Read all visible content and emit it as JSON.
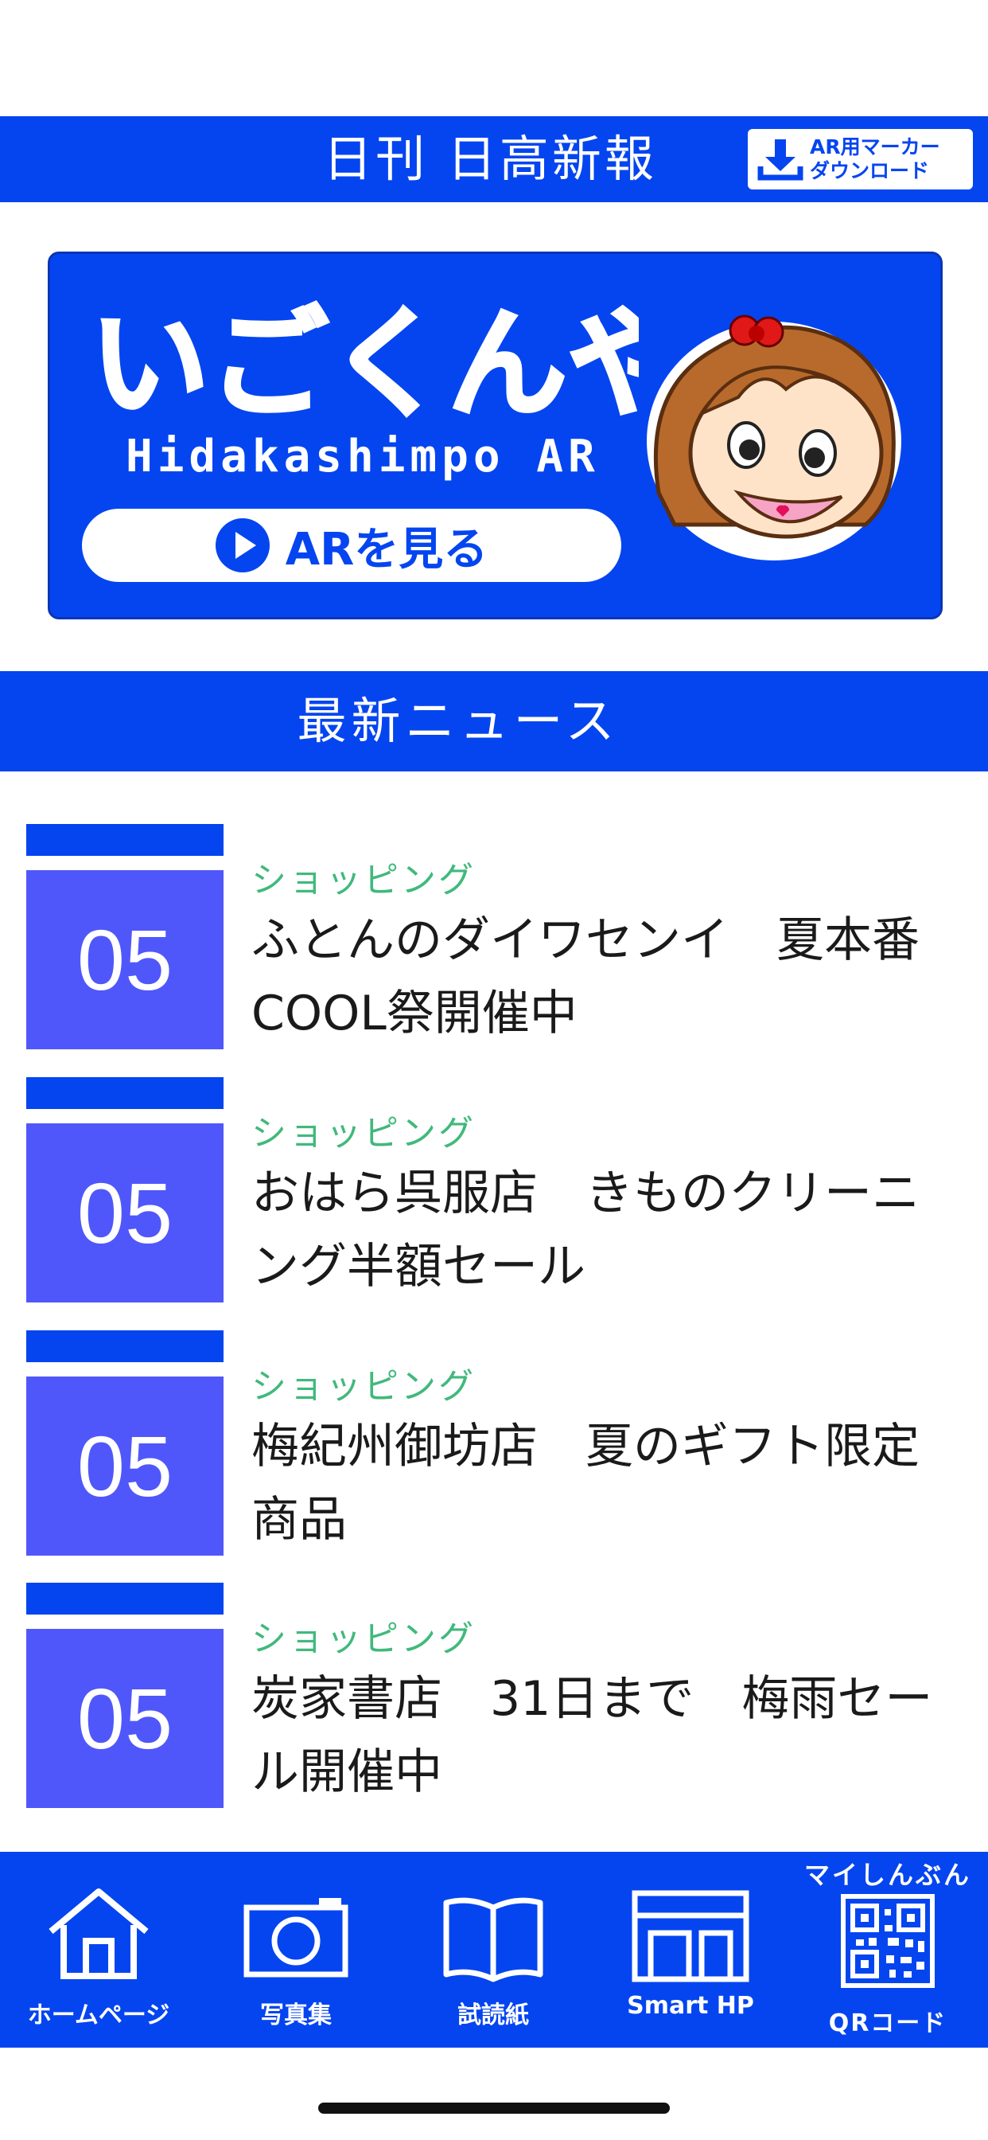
{
  "header": {
    "title": "日刊 日高新報",
    "ar_download_line1": "AR用マーカー",
    "ar_download_line2": "ダウンロード"
  },
  "banner": {
    "logo_text": "いごくんや",
    "subtitle": "Hidakashimpo AR",
    "button_label": "ARを見る"
  },
  "section": {
    "title": "最新ニュース"
  },
  "news": [
    {
      "date": "05",
      "category": "ショッピング",
      "title": "ふとんのダイワセンイ　夏本番COOL祭開催中"
    },
    {
      "date": "05",
      "category": "ショッピング",
      "title": "おはら呉服店　きものクリーニング半額セール"
    },
    {
      "date": "05",
      "category": "ショッピング",
      "title": "梅紀州御坊店　夏のギフト限定商品"
    },
    {
      "date": "05",
      "category": "ショッピング",
      "title": "炭家書店　31日まで　梅雨セール開催中"
    }
  ],
  "tabs": [
    {
      "label": "ホームページ",
      "icon": "home-icon"
    },
    {
      "label": "写真集",
      "icon": "camera-icon"
    },
    {
      "label": "試読紙",
      "icon": "book-icon"
    },
    {
      "label": "Smart HP",
      "icon": "smart-hp-icon"
    },
    {
      "label": "QRコード",
      "top_label": "マイしんぶん",
      "icon": "qr-code-icon"
    }
  ],
  "colors": {
    "brand_blue": "#0545f0",
    "date_box": "#5057fa",
    "category_green": "#41b97c"
  }
}
